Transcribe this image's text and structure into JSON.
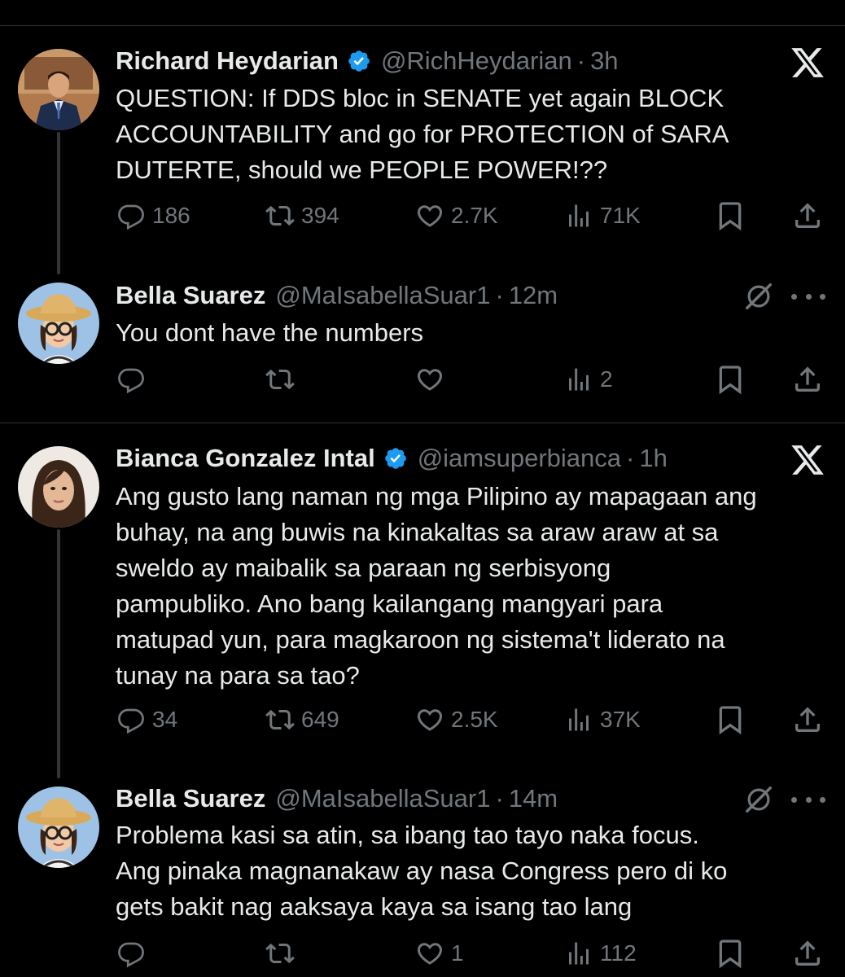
{
  "tweets": [
    {
      "name": "Richard Heydarian",
      "verified": true,
      "handle": "@RichHeydarian",
      "separator": "·",
      "time": "3h",
      "text": "QUESTION: If DDS bloc in SENATE yet again BLOCK\nACCOUNTABILITY and go for PROTECTION of SARA\nDUTERTE, should we PEOPLE POWER!??",
      "replies": "186",
      "reposts": "394",
      "likes": "2.7K",
      "views": "71K",
      "corner_icon": "x-logo-icon"
    },
    {
      "name": "Bella Suarez",
      "verified": false,
      "handle": "@MaIsabellaSuar1",
      "separator": "·",
      "time": "12m",
      "text": "You dont have the numbers",
      "replies": "",
      "reposts": "",
      "likes": "",
      "views": "2",
      "corner_icon": "grok-icon"
    },
    {
      "name": "Bianca Gonzalez Intal",
      "verified": true,
      "handle": "@iamsuperbianca",
      "separator": "·",
      "time": "1h",
      "text": "Ang gusto lang naman ng mga Pilipino ay mapagaan ang\nbuhay, na ang buwis na kinakaltas sa araw araw at sa\nsweldo ay maibalik sa paraan ng serbisyong\npampubliko. Ano bang kailangang mangyari para\nmatupad yun, para magkaroon ng sistema't liderato na\ntunay na para sa tao?",
      "replies": "34",
      "reposts": "649",
      "likes": "2.5K",
      "views": "37K",
      "corner_icon": "x-logo-icon"
    },
    {
      "name": "Bella Suarez",
      "verified": false,
      "handle": "@MaIsabellaSuar1",
      "separator": "·",
      "time": "14m",
      "text": "Problema kasi sa atin, sa ibang tao tayo naka focus.\nAng pinaka magnanakaw ay nasa Congress pero di ko\ngets bakit nag aaksaya kaya sa isang tao lang",
      "replies": "",
      "reposts": "",
      "likes": "1",
      "views": "112",
      "corner_icon": "grok-icon"
    }
  ],
  "colors": {
    "background": "#000000",
    "text": "#e7e9ea",
    "muted": "#71767b",
    "verified": "#1d9bf0",
    "divider": "#2f3336"
  }
}
